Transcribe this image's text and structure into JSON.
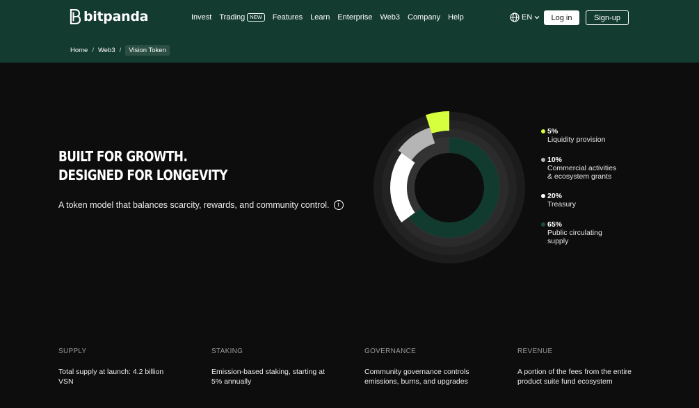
{
  "header": {
    "logo_text": "bitpanda",
    "nav": [
      {
        "label": "Invest"
      },
      {
        "label": "Trading",
        "badge": "NEW"
      },
      {
        "label": "Features"
      },
      {
        "label": "Learn"
      },
      {
        "label": "Enterprise"
      },
      {
        "label": "Web3"
      },
      {
        "label": "Company"
      },
      {
        "label": "Help"
      }
    ],
    "language": "EN",
    "login_label": "Log in",
    "signup_label": "Sign-up"
  },
  "breadcrumb": {
    "items": [
      "Home",
      "Web3"
    ],
    "current": "Vision Token"
  },
  "hero": {
    "headline_line1": "BUILT FOR GROWTH.",
    "headline_line2": "DESIGNED FOR LONGEVITY",
    "subtext": "A token model that balances scarcity, rewards, and community control."
  },
  "chart_data": {
    "type": "pie",
    "series": [
      {
        "name": "Liquidity provision",
        "value": 5,
        "label": "5%",
        "color": "#d6ff3d"
      },
      {
        "name": "Commercial activities & ecosystem grants",
        "value": 10,
        "label": "10%",
        "color": "#b5b5b5"
      },
      {
        "name": "Treasury",
        "value": 20,
        "label": "20%",
        "color": "#ffffff"
      },
      {
        "name": "Public circulating supply",
        "value": 65,
        "label": "65%",
        "color": "#123b30"
      }
    ]
  },
  "legend": [
    {
      "pct": "5%",
      "lines": [
        "Liquidity provision"
      ]
    },
    {
      "pct": "10%",
      "lines": [
        "Commercial activities",
        "& ecosystem grants"
      ]
    },
    {
      "pct": "20%",
      "lines": [
        "Treasury"
      ]
    },
    {
      "pct": "65%",
      "lines": [
        "Public circulating",
        "supply"
      ]
    }
  ],
  "stats": [
    {
      "title": "SUPPLY",
      "desc_line1": "Total supply at launch: 4.2 billion",
      "desc_line2": "VSN"
    },
    {
      "title": "STAKING",
      "desc_line1": "Emission-based staking, starting at",
      "desc_line2": "5% annually"
    },
    {
      "title": "GOVERNANCE",
      "desc_line1": "Community governance controls",
      "desc_line2": "emissions, burns, and upgrades"
    },
    {
      "title": "REVENUE",
      "desc_line1": "A portion of the fees from the entire",
      "desc_line2": "product suite fund ecosystem"
    }
  ],
  "icons": {
    "logo": "bitpanda-logo-icon",
    "globe": "globe-icon",
    "chevron": "chevron-down-icon",
    "info": "info-icon"
  }
}
